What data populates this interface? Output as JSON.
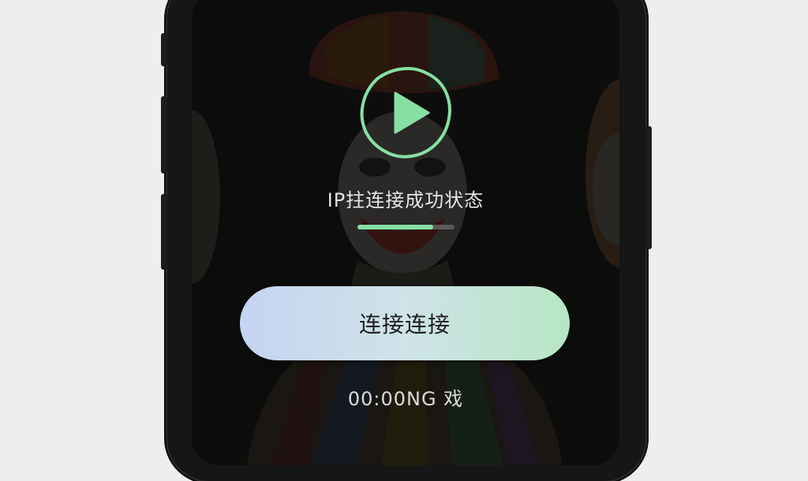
{
  "status_text": "IP拄连接成功状态",
  "progress": 0.78,
  "connect_button_label": "连接连接",
  "timer_text": "00:00NG 戏",
  "icons": {
    "play": "play-icon"
  },
  "colors": {
    "accent_green": "#86e0a4",
    "button_gradient_start": "#c5d4f2",
    "button_gradient_end": "#b6e6c3"
  }
}
